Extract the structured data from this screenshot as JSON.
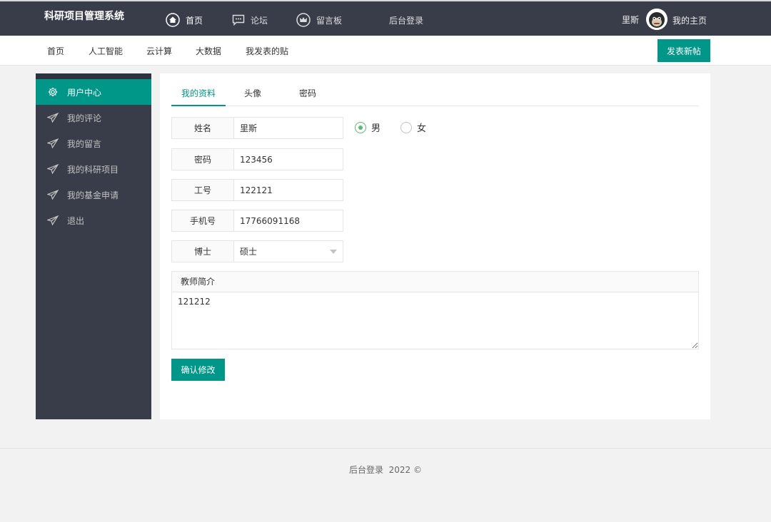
{
  "header": {
    "logo": "科研项目管理系统",
    "nav": [
      {
        "label": "首页",
        "icon": "home-icon"
      },
      {
        "label": "论坛",
        "icon": "chat-icon"
      },
      {
        "label": "留言板",
        "icon": "crown-icon"
      },
      {
        "label": "后台登录"
      }
    ],
    "user_name": "里斯",
    "my_home": "我的主页"
  },
  "subnav": {
    "items": [
      "首页",
      "人工智能",
      "云计算",
      "大数据",
      "我发表的贴"
    ],
    "post_button": "发表新帖"
  },
  "sidebar": {
    "items": [
      {
        "label": "用户中心",
        "icon": "gear-icon",
        "active": true
      },
      {
        "label": "我的评论",
        "icon": "paper-plane-icon"
      },
      {
        "label": "我的留言",
        "icon": "paper-plane-icon"
      },
      {
        "label": "我的科研项目",
        "icon": "paper-plane-icon"
      },
      {
        "label": "我的基金申请",
        "icon": "paper-plane-icon"
      },
      {
        "label": "退出",
        "icon": "paper-plane-icon"
      }
    ]
  },
  "tabs": [
    "我的资料",
    "头像",
    "密码"
  ],
  "form": {
    "name_label": "姓名",
    "name_value": "里斯",
    "gender_options": [
      "男",
      "女"
    ],
    "gender_selected": "男",
    "password_label": "密码",
    "password_value": "123456",
    "id_label": "工号",
    "id_value": "122121",
    "phone_label": "手机号",
    "phone_value": "17766091168",
    "degree_label": "博士",
    "degree_value": "硕士",
    "bio_label": "教师简介",
    "bio_value": "121212",
    "submit_label": "确认修改"
  },
  "footer": {
    "text": "后台登录  2022 ©"
  },
  "colors": {
    "accent": "#009688",
    "header_bg": "#393d49",
    "radio_checked": "#5fb878"
  }
}
